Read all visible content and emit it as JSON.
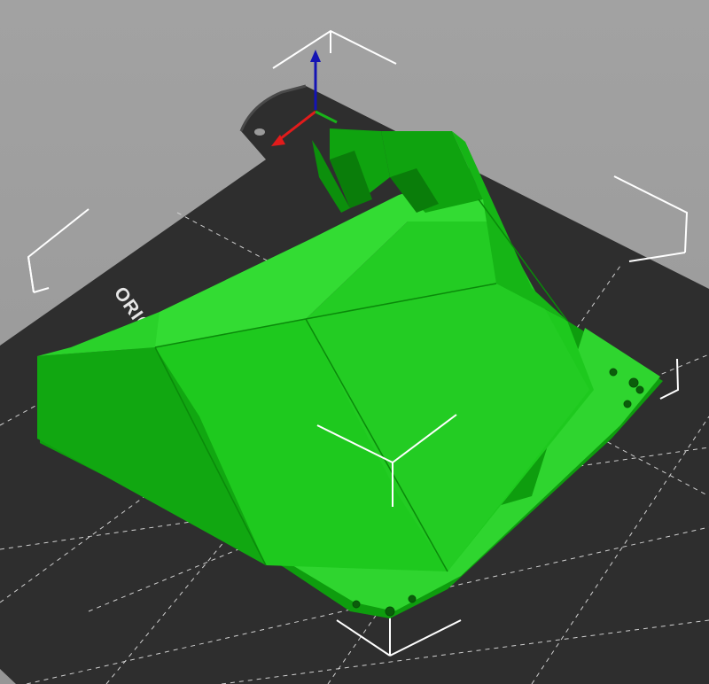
{
  "viewport": {
    "background_color": "#9a9a9a",
    "bed": {
      "label": "ORIGINAL PR",
      "sheet_color": "#2e2e2e",
      "grid_color": "#cfcfcf",
      "label_color": "#e6e6e6"
    },
    "model": {
      "color": "#1ec91e",
      "shadow_color": "#0e9d0e",
      "highlight_color": "#3fe53a"
    },
    "axes": {
      "x_color": "#e21b1b",
      "y_color": "#19b219",
      "z_color": "#1414b4"
    },
    "icons": [
      "axes-gizmo-icon",
      "bed-corner-marker-icon",
      "model-center-gizmo-icon"
    ]
  }
}
